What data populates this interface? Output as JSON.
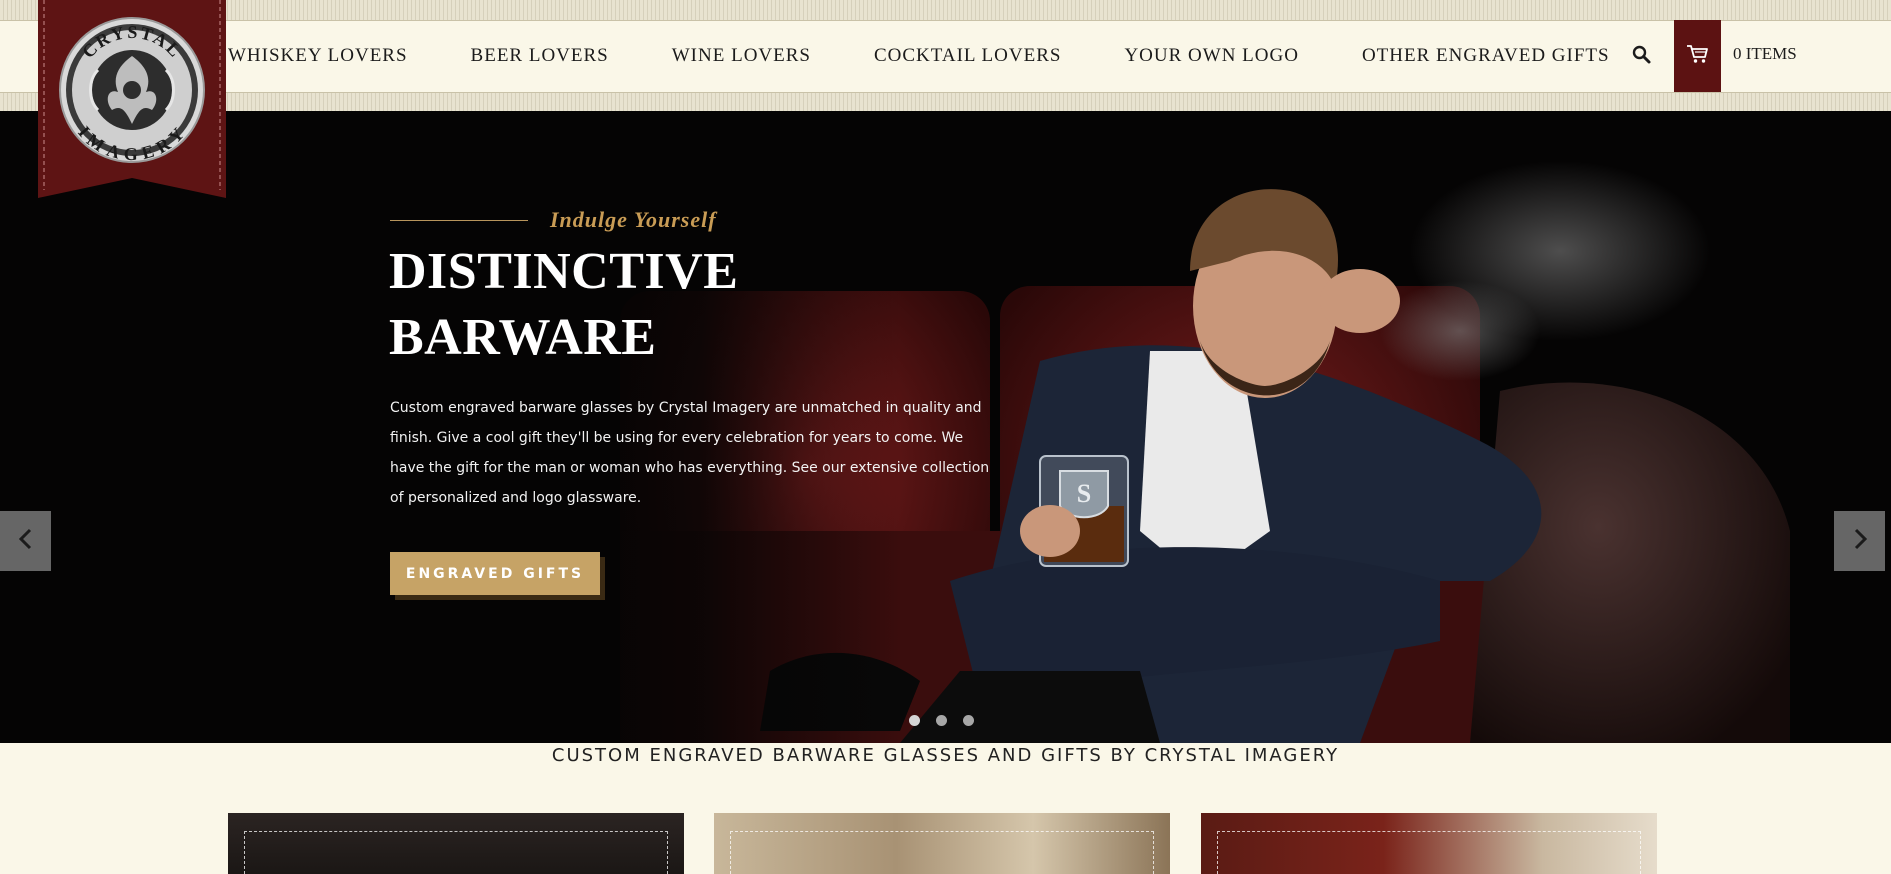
{
  "logo": {
    "top_text": "CRYSTAL",
    "bottom_text": "IMAGERY"
  },
  "nav": {
    "items": [
      "WHISKEY LOVERS",
      "BEER LOVERS",
      "WINE LOVERS",
      "COCKTAIL LOVERS",
      "YOUR OWN LOGO",
      "OTHER ENGRAVED GIFTS"
    ],
    "search_icon": "search-icon",
    "cart_icon": "cart-icon",
    "cart_count": "0 ITEMS"
  },
  "hero": {
    "kicker": "Indulge Yourself",
    "title": "DISTINCTIVE BARWARE",
    "text": "Custom engraved barware glasses by Crystal Imagery are unmatched in quality and finish. Give a cool gift they'll be using for every celebration for years to come. We have the gift for the man or woman who has everything. See our extensive collection of personalized and logo glassware.",
    "button": "ENGRAVED GIFTS",
    "glass_monogram": "S",
    "slides": 3,
    "active_slide": 1
  },
  "tagline": "CUSTOM ENGRAVED BARWARE GLASSES AND GIFTS BY CRYSTAL IMAGERY",
  "colors": {
    "background": "#faf7e8",
    "brand_red": "#5c1212",
    "gold": "#c6a366",
    "hero_bg": "#050404"
  }
}
